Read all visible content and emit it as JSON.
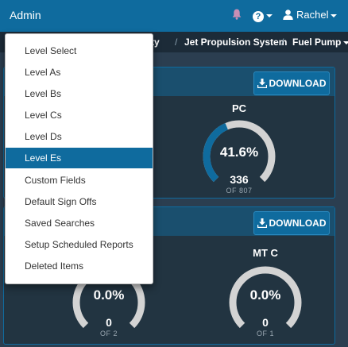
{
  "navbar": {
    "brand": "Admin",
    "help_glyph": "?",
    "user_name": "Rachel",
    "icons": [
      "bell-icon",
      "question-circle-icon",
      "user-icon",
      "caret-down-icon"
    ]
  },
  "breadcrumb": {
    "items": [
      "tility",
      "Jet Propulsion System",
      "Fuel Pump"
    ]
  },
  "panels": [
    {
      "download_label": "DOWNLOAD",
      "gauges": [
        {
          "title": "PC",
          "percent_text": "41.6%",
          "count": "336",
          "of_text": "OF 807",
          "fraction": 0.416
        }
      ]
    },
    {
      "download_label": "DOWNLOAD",
      "gauges": [
        {
          "title": "",
          "percent_text": "0.0%",
          "count": "0",
          "of_text": "OF 2",
          "fraction": 0
        },
        {
          "title": "MT C",
          "percent_text": "0.0%",
          "count": "0",
          "of_text": "OF 1",
          "fraction": 0
        }
      ]
    }
  ],
  "dropdown": {
    "items": [
      "Level Select",
      "Level As",
      "Level Bs",
      "Level Cs",
      "Level Ds",
      "Level Es",
      "Custom Fields",
      "Default Sign Offs",
      "Saved Searches",
      "Setup Scheduled Reports",
      "Deleted Items"
    ],
    "active": "Level Es"
  },
  "colors": {
    "accent": "#0f6b9e",
    "background": "#2b3e50",
    "gauge_track": "#d3d3d3",
    "gauge_fill": "#0f6b9e",
    "bell": "#c98fb5"
  }
}
